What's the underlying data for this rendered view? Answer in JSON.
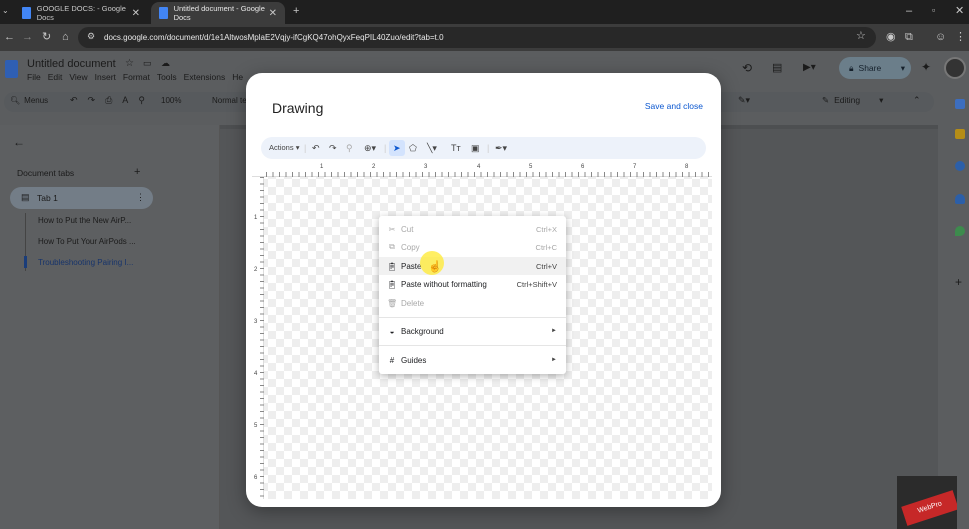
{
  "browser": {
    "tabs": [
      {
        "title": "GOOGLE DOCS: - Google Docs"
      },
      {
        "title": "Untitled document - Google Docs"
      }
    ],
    "url": "docs.google.com/document/d/1e1AltwosMplaE2Vqjy-ifCgKQ47ohQyxFeqPIL40Zuo/edit?tab=t.0"
  },
  "docs": {
    "title": "Untitled document",
    "menu": [
      "File",
      "Edit",
      "View",
      "Insert",
      "Format",
      "Tools",
      "Extensions",
      "He"
    ],
    "toolbar": {
      "menus_label": "Menus",
      "zoom": "100%",
      "style": "Normal te",
      "mode": "Editing"
    },
    "share_label": "Share",
    "sidebar": {
      "heading": "Document tabs",
      "tab": "Tab 1",
      "items": [
        "How to Put the New AirP...",
        "How To Put Your AirPods ...",
        "Troubleshooting Pairing I..."
      ]
    }
  },
  "drawing": {
    "title": "Drawing",
    "save_close": "Save and close",
    "actions_label": "Actions",
    "ruler_h": [
      "1",
      "2",
      "3",
      "4",
      "5",
      "6",
      "7",
      "8"
    ],
    "ruler_v": [
      "1",
      "2",
      "3",
      "4",
      "5",
      "6"
    ]
  },
  "context_menu": {
    "items": [
      {
        "label": "Cut",
        "shortcut": "Ctrl+X",
        "icon": "scissors-icon"
      },
      {
        "label": "Copy",
        "shortcut": "Ctrl+C",
        "icon": "copy-icon"
      },
      {
        "label": "Paste",
        "shortcut": "Ctrl+V",
        "icon": "paste-icon"
      },
      {
        "label": "Paste without formatting",
        "shortcut": "Ctrl+Shift+V",
        "icon": "paste-plain-icon"
      },
      {
        "label": "Delete",
        "shortcut": "",
        "icon": "trash-icon"
      },
      {
        "label": "Background",
        "shortcut": "",
        "icon": "bucket-icon"
      },
      {
        "label": "Guides",
        "shortcut": "",
        "icon": "grid-icon"
      }
    ]
  },
  "watermark": {
    "text": "WebPro"
  },
  "colors": {
    "accent": "#0b57d0",
    "share_bg": "#c2e7ff",
    "highlight": "#ffeb3c"
  }
}
